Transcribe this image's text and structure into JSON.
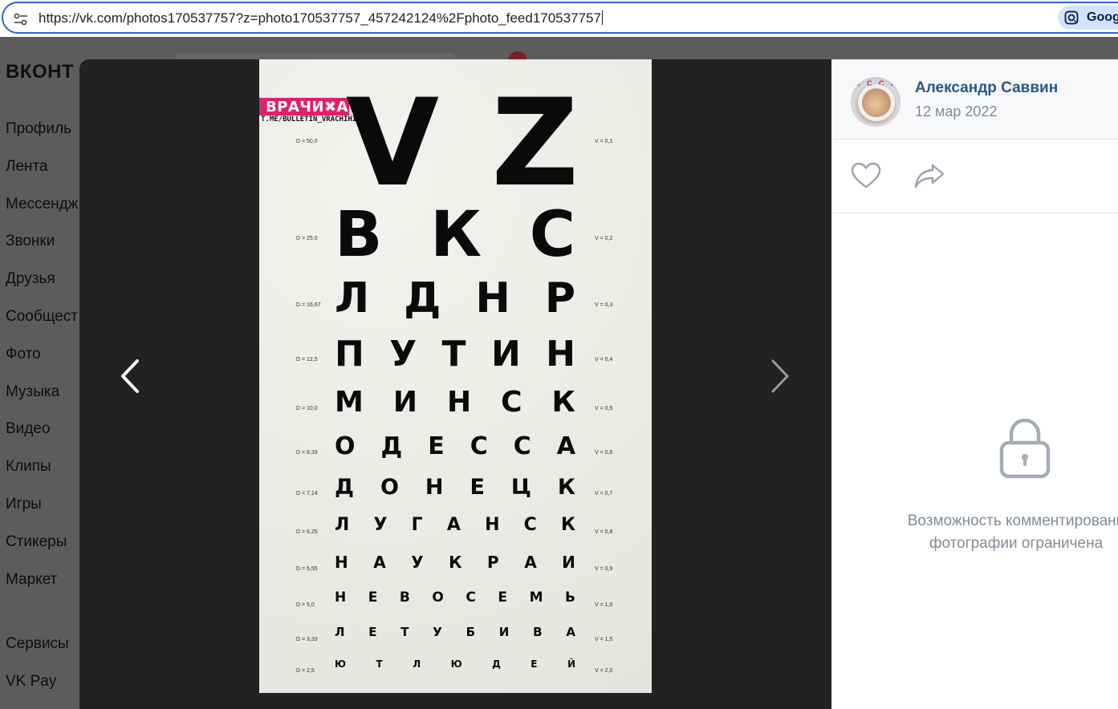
{
  "browser": {
    "url": "https://vk.com/photos170537757?z=photo170537757_457242124%2Fphoto_feed170537757",
    "lens_label": "Goog"
  },
  "vk": {
    "logo": "ВКОНТ",
    "nav": [
      "Профиль",
      "Лента",
      "Мессендж",
      "Звонки",
      "Друзья",
      "Сообщест",
      "Фото",
      "Музыка",
      "Видео",
      "Клипы",
      "Игры",
      "Стикеры",
      "Маркет"
    ],
    "nav_bottom": [
      "Сервисы",
      "VK Pay"
    ]
  },
  "viewer": {
    "author": "Александр Саввин",
    "date": "12 мар 2022",
    "avatar_text": "С С С Р",
    "restricted_line1": "Возможность комментировани",
    "restricted_line2": "фотографии ограничена",
    "icons": {
      "prev": "chevron-left-icon",
      "next": "chevron-right-icon",
      "like": "heart-icon",
      "share": "share-icon",
      "lock": "lock-icon"
    }
  },
  "photo": {
    "brand": "ВРАЧИ✖А",
    "brand_link": "T.ME/BULLETIN_VRACHIHI",
    "rows": [
      {
        "d": "D = 50,0",
        "v": "V = 0,1",
        "letters": [
          "V",
          "Z"
        ]
      },
      {
        "d": "D = 25,0",
        "v": "V = 0,2",
        "letters": [
          "В",
          "К",
          "С"
        ]
      },
      {
        "d": "D = 16,67",
        "v": "V = 0,3",
        "letters": [
          "Л",
          "Д",
          "Н",
          "Р"
        ]
      },
      {
        "d": "D = 12,5",
        "v": "V = 0,4",
        "letters": [
          "П",
          "У",
          "Т",
          "И",
          "Н"
        ]
      },
      {
        "d": "D = 10,0",
        "v": "V = 0,5",
        "letters": [
          "М",
          "И",
          "Н",
          "С",
          "К"
        ]
      },
      {
        "d": "D = 8,33",
        "v": "V = 0,6",
        "letters": [
          "О",
          "Д",
          "Е",
          "С",
          "С",
          "А"
        ]
      },
      {
        "d": "D = 7,14",
        "v": "V = 0,7",
        "letters": [
          "Д",
          "О",
          "Н",
          "Е",
          "Ц",
          "К"
        ]
      },
      {
        "d": "D = 6,25",
        "v": "V = 0,8",
        "letters": [
          "Л",
          "У",
          "Г",
          "А",
          "Н",
          "С",
          "К"
        ]
      },
      {
        "d": "D = 5,55",
        "v": "V = 0,9",
        "letters": [
          "Н",
          "А",
          "У",
          "К",
          "Р",
          "А",
          "И"
        ]
      },
      {
        "d": "D = 5,0",
        "v": "V = 1,0",
        "letters": [
          "Н",
          "Е",
          "В",
          "О",
          "С",
          "Е",
          "М",
          "Ь"
        ]
      },
      {
        "d": "D = 3,33",
        "v": "V = 1,5",
        "letters": [
          "Л",
          "Е",
          "Т",
          "У",
          "Б",
          "И",
          "В",
          "А"
        ]
      },
      {
        "d": "D = 2,5",
        "v": "V = 2,0",
        "letters": [
          "Ю",
          "Т",
          "Л",
          "Ю",
          "Д",
          "Е",
          "Й"
        ]
      }
    ]
  }
}
